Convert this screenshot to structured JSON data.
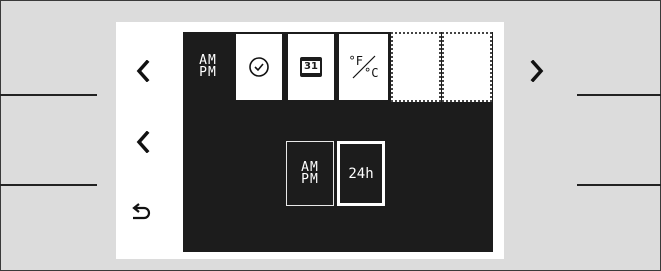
{
  "tabs": {
    "ampm": {
      "line1": "AM",
      "line2": "PM",
      "selected": true
    },
    "clock": {
      "icon": "clock-icon"
    },
    "date": {
      "icon": "calendar-icon",
      "day": "31"
    },
    "units": {
      "icon": "temperature-unit-icon",
      "deg_f": "°F",
      "deg_c": "°C"
    },
    "empty1": {
      "icon": "empty-slot"
    },
    "empty2": {
      "icon": "empty-slot"
    }
  },
  "options": {
    "ampm": {
      "line1": "AM",
      "line2": "PM",
      "selected": false
    },
    "h24": {
      "label": "24h",
      "selected": true
    }
  },
  "nav": {
    "prev_top": "chevron-left-icon",
    "next_top": "chevron-right-icon",
    "prev_mid": "chevron-left-icon",
    "back": "back-arrow-icon"
  },
  "colors": {
    "screen": "#1c1c1c",
    "panel": "#ffffff",
    "bezel": "#dcdcdc"
  }
}
